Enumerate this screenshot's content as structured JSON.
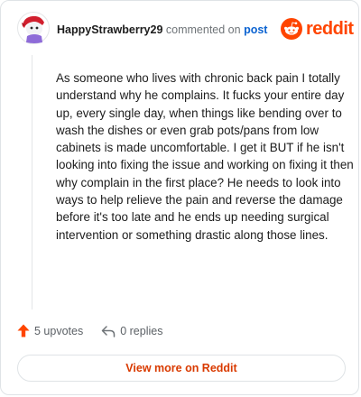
{
  "comment": {
    "username": "HappyStrawberry29",
    "action_text": "commented on",
    "post_link": "post",
    "text": "As someone who lives with chronic back pain I totally understand why he complains. It fucks your entire day up, every single day, when things like bending over to wash the dishes or even grab pots/pans from low cabinets is made uncomfortable. I get it BUT if he isn't looking into fixing the issue and working on fixing it then why complain in the first place? He needs to look into ways to help relieve the pain and reverse the damage before it's too late and he ends up needing surgical intervention or something drastic along those lines."
  },
  "brand": {
    "name": "reddit",
    "color": "#ff4500"
  },
  "actions": {
    "upvotes": "5 upvotes",
    "replies": "0 replies"
  },
  "footer": {
    "view_more": "View more on Reddit"
  },
  "icons": {
    "avatar": "user-avatar-icon",
    "logo": "reddit-snoo-icon",
    "upvote": "upvote-arrow-icon",
    "reply": "reply-arrow-icon"
  },
  "colors": {
    "username": "#1c1c1c",
    "link": "#0b63d1",
    "upvote": "#ff4500",
    "view_more": "#d93a00"
  }
}
